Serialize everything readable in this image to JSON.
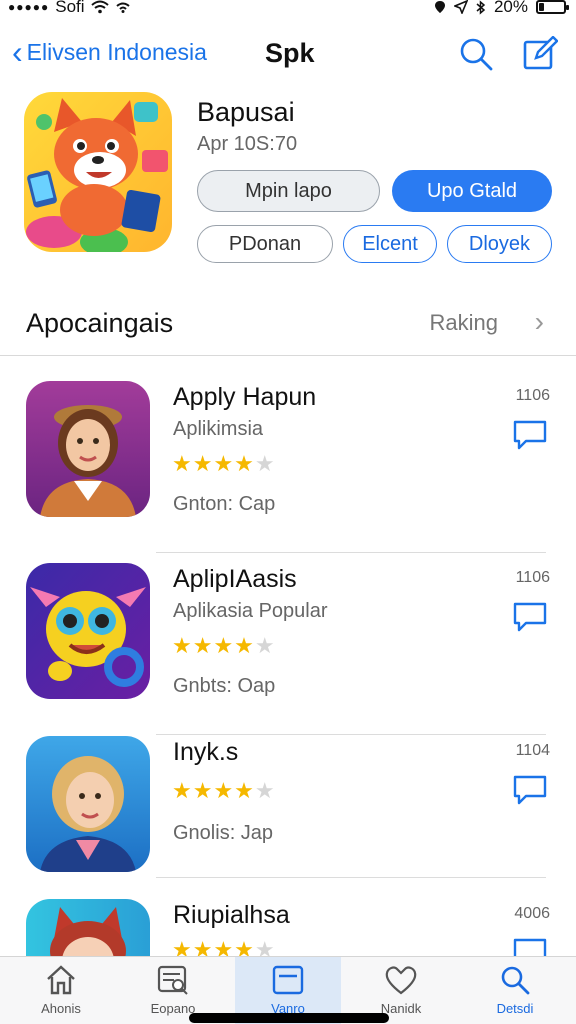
{
  "status_bar": {
    "carrier": "Sofi",
    "battery_text": "20%",
    "battery_level": 0.2
  },
  "nav": {
    "back_label": "Elivsen Indonesia",
    "title": "Spk"
  },
  "hero": {
    "title": "Bapusai",
    "subtitle": "Apr 10S:70",
    "buttons": {
      "primary_gray": "Mpin lapo",
      "primary_blue": "Upo Gtald",
      "secondary_1": "PDonan",
      "secondary_2": "Elcent",
      "secondary_3": "Dloyek"
    }
  },
  "section": {
    "title": "Apocaingais",
    "link": "Raking",
    "chevron": "›"
  },
  "apps": [
    {
      "name": "Apply Hapun",
      "subtitle": "Aplikimsia",
      "rating": 4,
      "meta": "Gnton: Cap",
      "count": "1106"
    },
    {
      "name": "AplipIAasis",
      "subtitle": "Aplikasia Popular",
      "rating": 4,
      "meta": "Gnbts: Oap",
      "count": "1106"
    },
    {
      "name": "Inyk.s",
      "subtitle": "",
      "rating": 4,
      "meta": "Gnolis: Jap",
      "count": "1104"
    },
    {
      "name": "Riupialhsa",
      "subtitle": "",
      "rating": 4,
      "meta": "",
      "count": "4006"
    }
  ],
  "tabs": [
    {
      "label": "Ahonis",
      "icon": "home-icon"
    },
    {
      "label": "Eopano",
      "icon": "list-search-icon"
    },
    {
      "label": "Vanro",
      "icon": "card-icon"
    },
    {
      "label": "Nanidk",
      "icon": "heart-icon"
    },
    {
      "label": "Detsdi",
      "icon": "search-icon"
    }
  ],
  "colors": {
    "accent": "#2a7bf2",
    "star": "#f5b800"
  }
}
